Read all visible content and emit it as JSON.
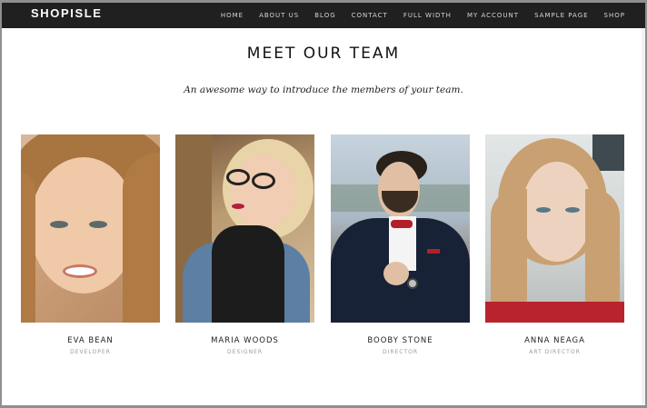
{
  "header": {
    "brand": "SHOPISLE",
    "nav": [
      "HOME",
      "ABOUT US",
      "BLOG",
      "CONTACT",
      "FULL WIDTH",
      "MY ACCOUNT",
      "SAMPLE PAGE",
      "SHOP"
    ]
  },
  "section": {
    "title": "MEET OUR TEAM",
    "subtitle": "An awesome way to introduce the members of your team."
  },
  "team": [
    {
      "name": "EVA BEAN",
      "role": "DEVELOPER"
    },
    {
      "name": "MARIA WOODS",
      "role": "DESIGNER"
    },
    {
      "name": "BOOBY STONE",
      "role": "DIRECTOR"
    },
    {
      "name": "ANNA NEAGA",
      "role": "ART DIRECTOR"
    }
  ],
  "colors": {
    "navbar_bg": "#202020",
    "page_bg": "#ffffff",
    "text_dark": "#111111",
    "text_muted": "#9a9a9a"
  }
}
